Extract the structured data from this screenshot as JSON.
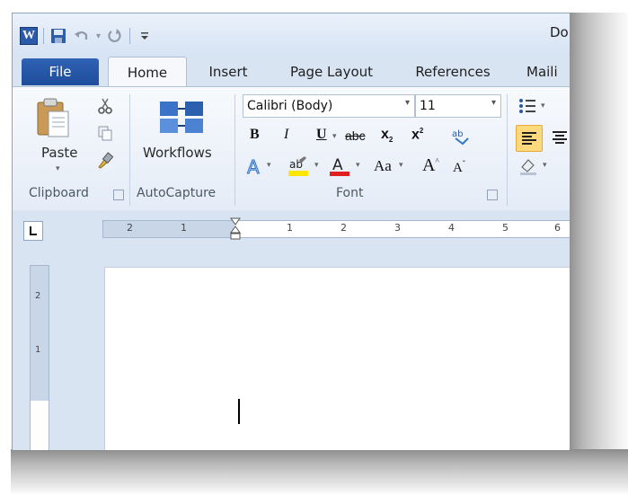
{
  "window": {
    "title_partial": "Do",
    "app_logo_letter": "W"
  },
  "tabs": [
    {
      "label": "File"
    },
    {
      "label": "Home"
    },
    {
      "label": "Insert"
    },
    {
      "label": "Page Layout"
    },
    {
      "label": "References"
    },
    {
      "label": "Maili"
    }
  ],
  "ribbon": {
    "clipboard": {
      "paste_label": "Paste",
      "group_label": "Clipboard"
    },
    "autocapture": {
      "workflows_label": "Workflows",
      "group_label": "AutoCapture"
    },
    "font": {
      "font_name": "Calibri (Body)",
      "font_size": "11",
      "group_label": "Font",
      "bold": "B",
      "italic": "I",
      "underline": "U",
      "strikethrough": "abc",
      "subscript": "x",
      "superscript": "x",
      "change_case": "Aa",
      "grow": "A",
      "shrink": "A",
      "font_color_letter": "A",
      "highlight_letters": "ab"
    }
  },
  "ruler": {
    "h_ticks": [
      "2",
      "1",
      "1",
      "2",
      "3",
      "4",
      "5",
      "6"
    ],
    "v_ticks": [
      "2",
      "1"
    ]
  },
  "colors": {
    "file_tab": "#2a5db0",
    "ribbon_bg": "#f3f6fb",
    "highlight_yellow": "#ffe600",
    "font_color_red": "#e02020"
  },
  "icons": [
    "word-logo-icon",
    "save-icon",
    "undo-icon",
    "redo-icon",
    "customize-qat-icon",
    "paste-icon",
    "cut-icon",
    "copy-icon",
    "format-painter-icon",
    "workflows-icon",
    "text-effects-icon",
    "highlight-icon",
    "font-color-icon",
    "clear-formatting-icon",
    "bullets-icon",
    "align-left-icon",
    "align-center-icon",
    "shading-icon",
    "tab-selector-icon",
    "indent-marker-icon"
  ]
}
